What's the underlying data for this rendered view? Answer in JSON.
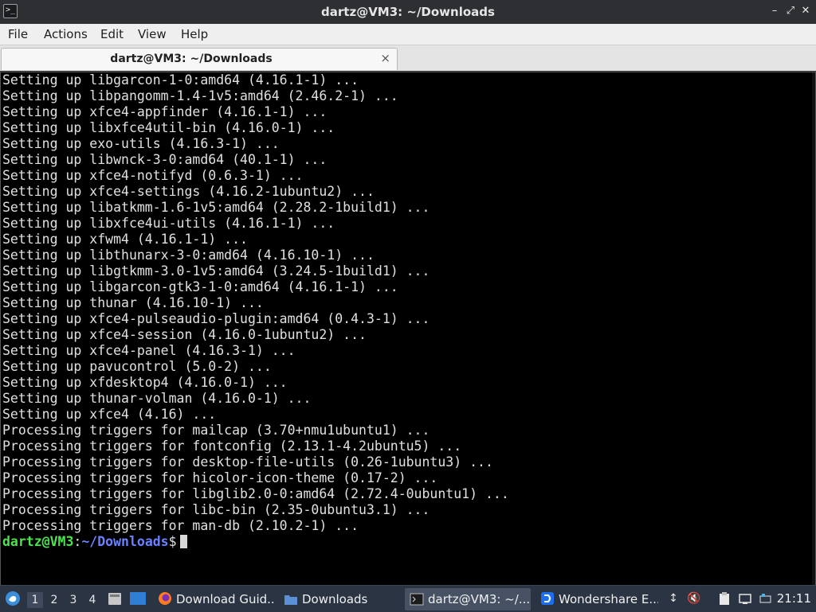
{
  "window": {
    "title": "dartz@VM3: ~/Downloads",
    "controls": [
      "minimize",
      "maximize",
      "close"
    ]
  },
  "menubar": {
    "items": [
      "File",
      "Actions",
      "Edit",
      "View",
      "Help"
    ]
  },
  "tab": {
    "label": "dartz@VM3: ~/Downloads",
    "close_glyph": "×"
  },
  "terminal": {
    "lines": [
      "Setting up libgarcon-1-0:amd64 (4.16.1-1) ...",
      "Setting up libpangomm-1.4-1v5:amd64 (2.46.2-1) ...",
      "Setting up xfce4-appfinder (4.16.1-1) ...",
      "Setting up libxfce4util-bin (4.16.0-1) ...",
      "Setting up exo-utils (4.16.3-1) ...",
      "Setting up libwnck-3-0:amd64 (40.1-1) ...",
      "Setting up xfce4-notifyd (0.6.3-1) ...",
      "Setting up xfce4-settings (4.16.2-1ubuntu2) ...",
      "Setting up libatkmm-1.6-1v5:amd64 (2.28.2-1build1) ...",
      "Setting up libxfce4ui-utils (4.16.1-1) ...",
      "Setting up xfwm4 (4.16.1-1) ...",
      "Setting up libthunarx-3-0:amd64 (4.16.10-1) ...",
      "Setting up libgtkmm-3.0-1v5:amd64 (3.24.5-1build1) ...",
      "Setting up libgarcon-gtk3-1-0:amd64 (4.16.1-1) ...",
      "Setting up thunar (4.16.10-1) ...",
      "Setting up xfce4-pulseaudio-plugin:amd64 (0.4.3-1) ...",
      "Setting up xfce4-session (4.16.0-1ubuntu2) ...",
      "Setting up xfce4-panel (4.16.3-1) ...",
      "Setting up pavucontrol (5.0-2) ...",
      "Setting up xfdesktop4 (4.16.0-1) ...",
      "Setting up thunar-volman (4.16.0-1) ...",
      "Setting up xfce4 (4.16) ...",
      "Processing triggers for mailcap (3.70+nmu1ubuntu1) ...",
      "Processing triggers for fontconfig (2.13.1-4.2ubuntu5) ...",
      "Processing triggers for desktop-file-utils (0.26-1ubuntu3) ...",
      "Processing triggers for hicolor-icon-theme (0.17-2) ...",
      "Processing triggers for libglib2.0-0:amd64 (2.72.4-0ubuntu1) ...",
      "Processing triggers for libc-bin (2.35-0ubuntu3.1) ...",
      "Processing triggers for man-db (2.10.2-1) ..."
    ],
    "prompt": {
      "user_host": "dartz@VM3",
      "colon": ":",
      "path": "~/Downloads",
      "symbol": "$"
    }
  },
  "panel": {
    "workspaces": [
      "1",
      "2",
      "3",
      "4"
    ],
    "active_workspace": "1",
    "tasks": [
      {
        "label": "Download Guid...",
        "icon": "firefox-icon",
        "active": false
      },
      {
        "label": "Downloads",
        "icon": "folder-icon",
        "active": false
      },
      {
        "label": "dartz@VM3: ~/...",
        "icon": "terminal-icon",
        "active": true
      },
      {
        "label": "Wondershare E...",
        "icon": "wondershare-icon",
        "active": false
      }
    ],
    "clock": "21:11"
  }
}
